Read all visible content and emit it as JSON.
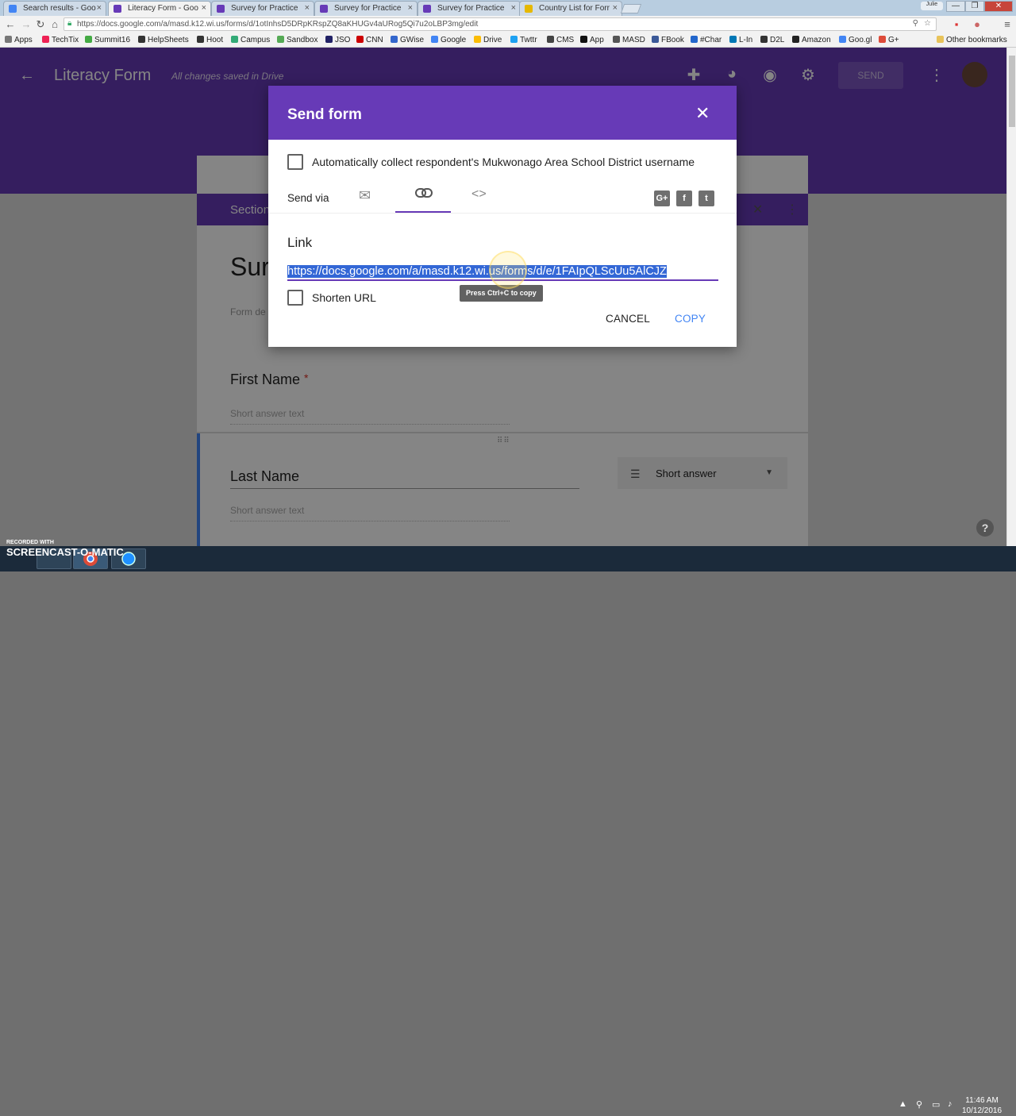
{
  "browser": {
    "tabs": [
      {
        "label": "Search results - Goo",
        "favicon_color": "#4285f4"
      },
      {
        "label": "Literacy Form - Goo",
        "favicon_color": "#673ab7"
      },
      {
        "label": "Survey for Practice",
        "favicon_color": "#673ab7"
      },
      {
        "label": "Survey for Practice",
        "favicon_color": "#673ab7"
      },
      {
        "label": "Survey for Practice",
        "favicon_color": "#673ab7"
      },
      {
        "label": "Country List for Forr",
        "favicon_color": "#e6b800"
      }
    ],
    "active_tab_index": 1,
    "user_badge": "Julie",
    "window_controls": [
      "—",
      "❐",
      "✕"
    ],
    "url": "https://docs.google.com/a/masd.k12.wi.us/forms/d/1otInhsD5DRpKRspZQ8aKHUGv4aURog5Qi7u2oLBP3mg/edit",
    "bookmarks": [
      {
        "label": "Apps",
        "color": "#777"
      },
      {
        "label": "TechTix",
        "color": "#e25"
      },
      {
        "label": "Summit16",
        "color": "#4a4"
      },
      {
        "label": "HelpSheets",
        "color": "#333"
      },
      {
        "label": "Hoot",
        "color": "#333"
      },
      {
        "label": "Campus",
        "color": "#3a7"
      },
      {
        "label": "Sandbox",
        "color": "#5a5"
      },
      {
        "label": "JSO",
        "color": "#226"
      },
      {
        "label": "CNN",
        "color": "#c00"
      },
      {
        "label": "GWise",
        "color": "#36c"
      },
      {
        "label": "Google",
        "color": "#4285f4"
      },
      {
        "label": "Drive",
        "color": "#fbbc05"
      },
      {
        "label": "Twttr",
        "color": "#1da1f2"
      },
      {
        "label": "CMS",
        "color": "#444"
      },
      {
        "label": "App",
        "color": "#111"
      },
      {
        "label": "MASD",
        "color": "#555"
      },
      {
        "label": "FBook",
        "color": "#3b5998"
      },
      {
        "label": "#Char",
        "color": "#2266cc"
      },
      {
        "label": "L-In",
        "color": "#0077b5"
      },
      {
        "label": "D2L",
        "color": "#333"
      },
      {
        "label": "Amazon",
        "color": "#222"
      },
      {
        "label": "Goo.gl",
        "color": "#4285f4"
      },
      {
        "label": "G+",
        "color": "#dd4b39"
      }
    ],
    "other_bookmarks": "Other bookmarks"
  },
  "app": {
    "form_title": "Literacy Form",
    "save_status": "All changes saved in Drive",
    "send_button": "SEND",
    "section_label": "Section",
    "form_title_big": "Sur",
    "form_description": "Form de",
    "questions": [
      {
        "label": "First Name",
        "required": "*",
        "placeholder": "Short answer text"
      },
      {
        "label": "Last Name",
        "placeholder": "Short answer text"
      }
    ],
    "question_type": "Short answer",
    "help": "?"
  },
  "dialog": {
    "title": "Send form",
    "collect_label": "Automatically collect respondent's Mukwonago Area School District username",
    "send_via": "Send via",
    "link_label": "Link",
    "link_url": "https://docs.google.com/a/masd.k12.wi.us/forms/d/e/1FAIpQLScUu5AlCJZ",
    "tooltip": "Press Ctrl+C to copy",
    "shorten_label": "Shorten URL",
    "cancel": "CANCEL",
    "copy": "COPY",
    "accent_color": "#673ab7"
  },
  "taskbar": {
    "watermark_small": "RECORDED WITH",
    "watermark_big": "SCREENCAST-O-MATIC",
    "time": "11:46 AM",
    "date": "10/12/2016"
  }
}
